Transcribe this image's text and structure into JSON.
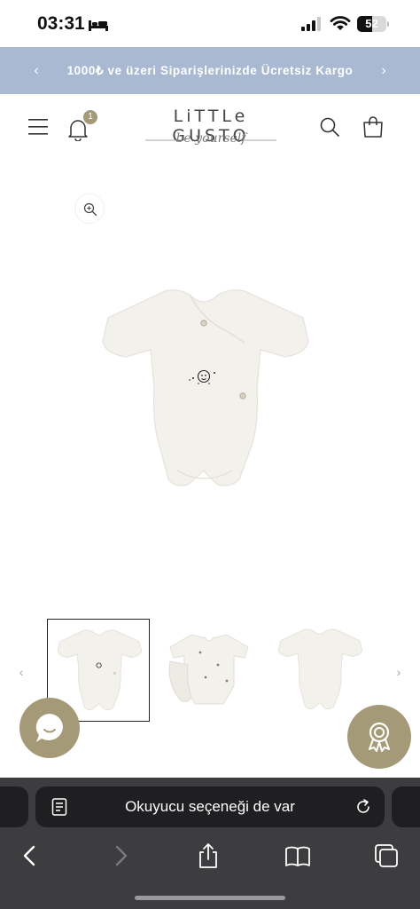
{
  "status_bar": {
    "time": "03:31",
    "battery_level": "52",
    "icons": [
      "bed-icon",
      "signal-icon",
      "wifi-icon",
      "battery-icon"
    ]
  },
  "announcement": {
    "text": "1000₺ ve üzeri Siparişlerinizde Ücretsiz Kargo",
    "prev": "‹",
    "next": "›"
  },
  "header": {
    "notification_count": "1",
    "logo_text": "LiTTLe GUSTO",
    "logo_tagline": "be yourself",
    "icons": [
      "menu-icon",
      "bell-icon",
      "search-icon",
      "cart-icon"
    ]
  },
  "gallery": {
    "zoom_icon": "zoom-in-icon",
    "thumbnail_count": 3,
    "selected_index": 0,
    "prev": "‹",
    "next": "›"
  },
  "floating": {
    "chat_icon": "chat-icon",
    "award_icon": "award-icon",
    "accent_color": "#a59a78"
  },
  "browser": {
    "address_text": "Okuyucu seçeneği de var",
    "icons": [
      "reader-icon",
      "reload-icon",
      "back-icon",
      "forward-icon",
      "share-icon",
      "bookmarks-icon",
      "tabs-icon"
    ]
  },
  "colors": {
    "announcement_bg": "#a9b9d2",
    "browser_bg": "#3d3d3f"
  }
}
